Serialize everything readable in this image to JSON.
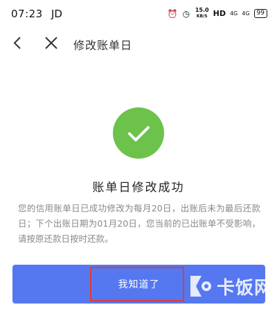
{
  "status_bar": {
    "time": "07:23",
    "carrier": "JD",
    "speed": "15.0",
    "speed_unit": "KB/S",
    "hd": "HD",
    "signal_1": "4G",
    "signal_2": "4G",
    "battery": "99"
  },
  "nav": {
    "title": "修改账单日"
  },
  "success": {
    "title": "账单日修改成功",
    "description": "您的信用账单日已成功修改为每月20日，出账后未为最后还款日；下个出账日期为01月20日，您当前的已出账单不受影响，请按原还款日按时还款。"
  },
  "button": {
    "label": "我知道了"
  },
  "watermark": {
    "text": "卡饭网"
  },
  "colors": {
    "success_green": "#6cc24a",
    "button_blue": "#5578f0",
    "highlight_red": "#e2393b"
  }
}
